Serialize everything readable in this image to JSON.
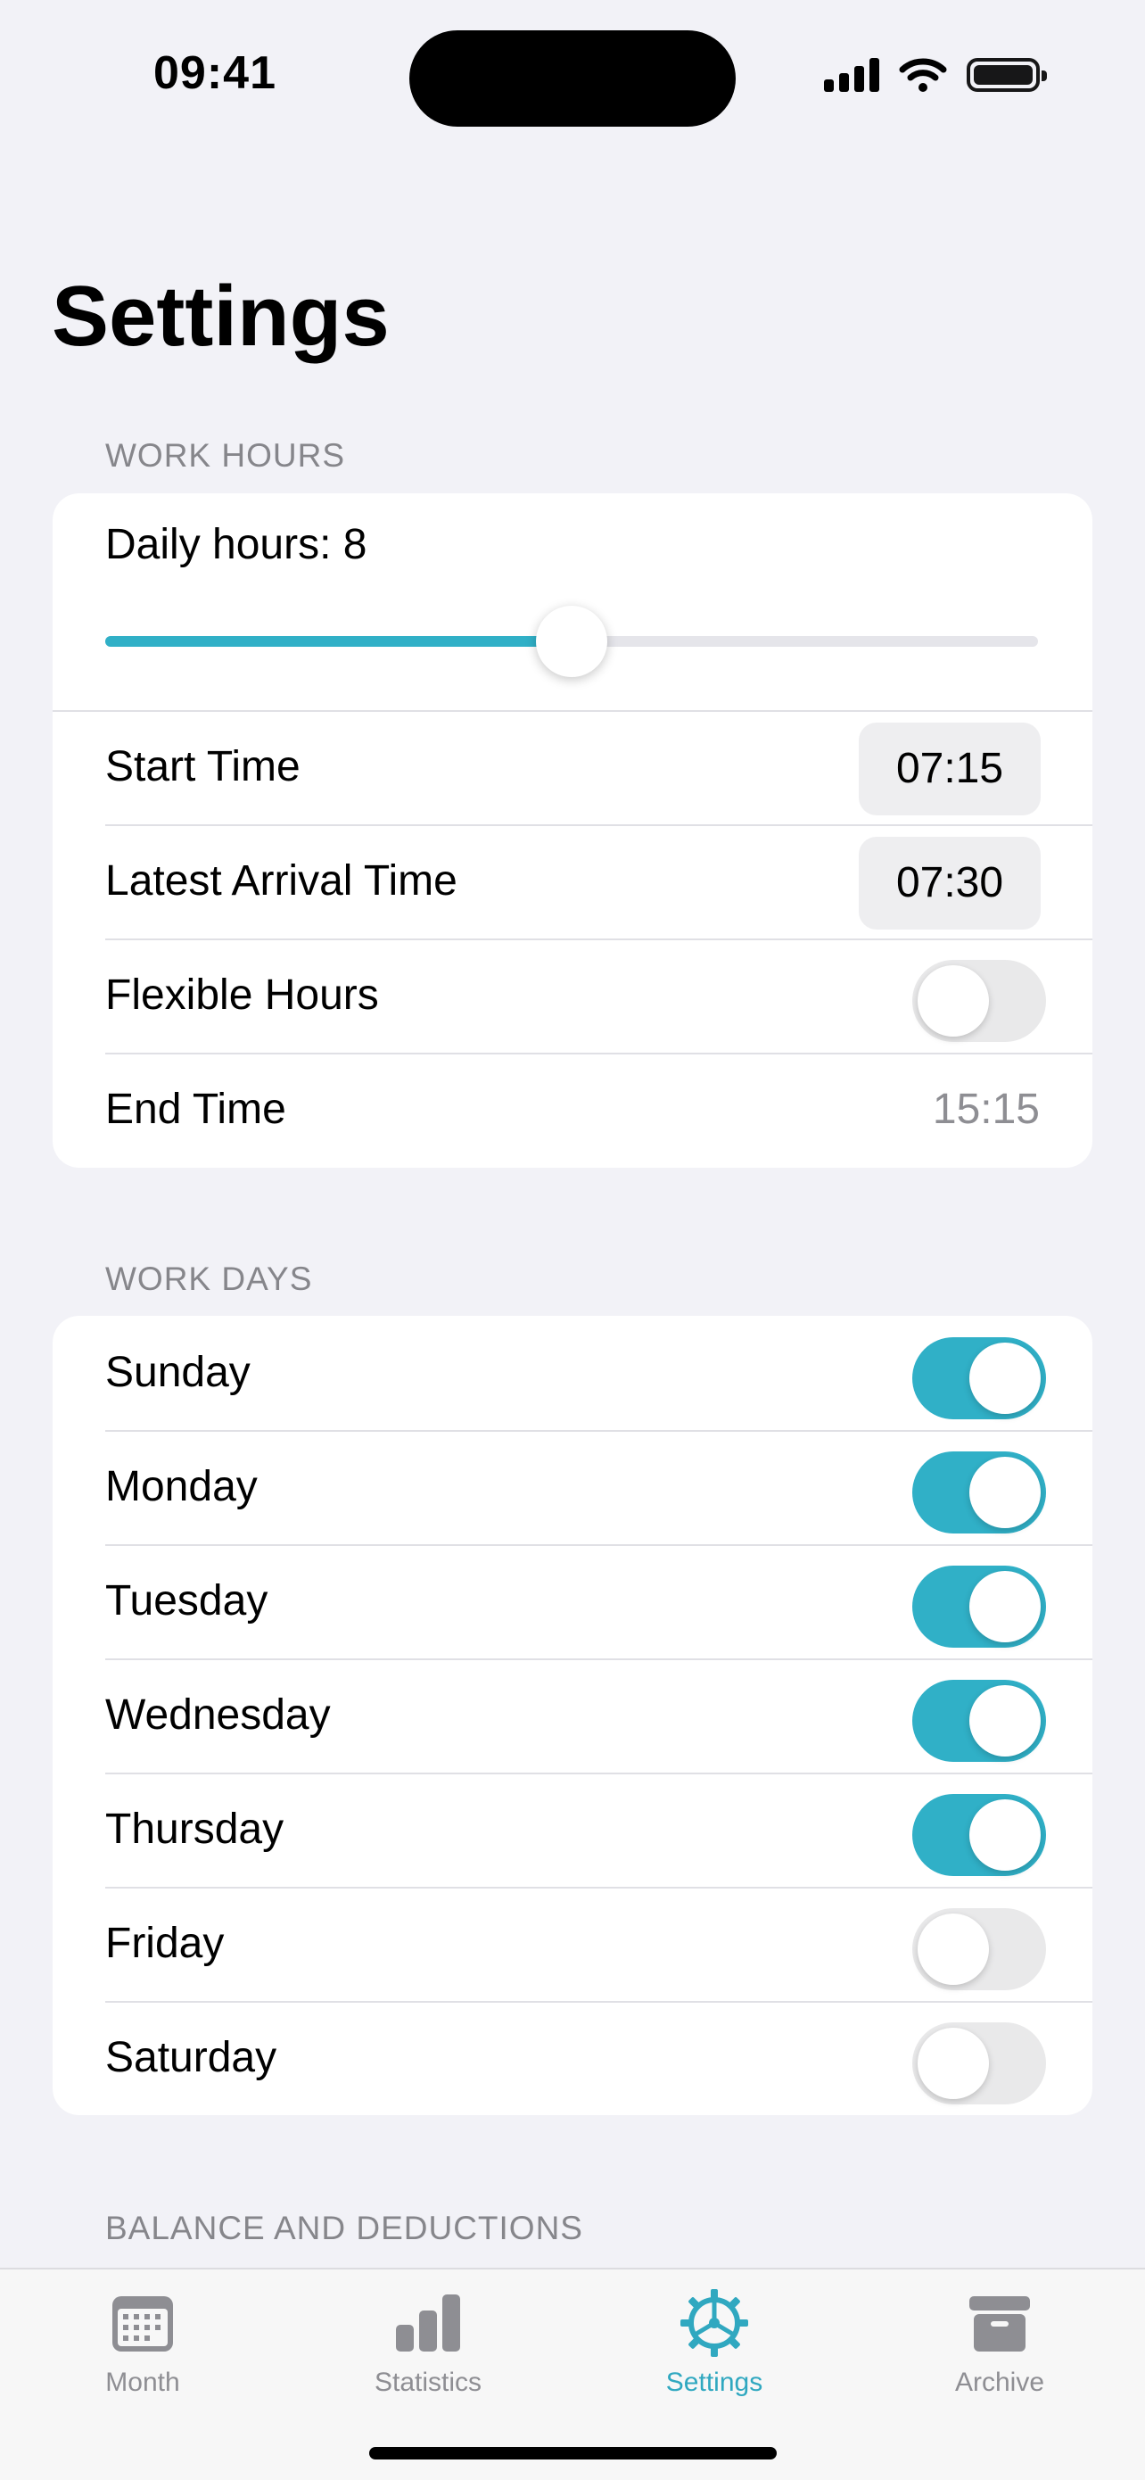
{
  "status_bar": {
    "time": "09:41"
  },
  "page_title": "Settings",
  "accent_color": "#30b0c7",
  "work_hours": {
    "header": "WORK HOURS",
    "daily_hours_label": "Daily hours: 8",
    "daily_hours_fraction": 0.5,
    "start_time_label": "Start Time",
    "start_time_value": "07:15",
    "latest_arrival_label": "Latest Arrival Time",
    "latest_arrival_value": "07:30",
    "flexible_hours_label": "Flexible Hours",
    "flexible_hours_on": false,
    "end_time_label": "End Time",
    "end_time_value": "15:15"
  },
  "work_days": {
    "header": "WORK DAYS",
    "days": [
      {
        "label": "Sunday",
        "on": true
      },
      {
        "label": "Monday",
        "on": true
      },
      {
        "label": "Tuesday",
        "on": true
      },
      {
        "label": "Wednesday",
        "on": true
      },
      {
        "label": "Thursday",
        "on": true
      },
      {
        "label": "Friday",
        "on": false
      },
      {
        "label": "Saturday",
        "on": false
      }
    ]
  },
  "balance_section": {
    "header": "BALANCE AND DEDUCTIONS"
  },
  "tab_bar": {
    "tabs": [
      {
        "label": "Month",
        "icon": "calendar-icon"
      },
      {
        "label": "Statistics",
        "icon": "bar-chart-icon"
      },
      {
        "label": "Settings",
        "icon": "gear-icon",
        "active": true
      },
      {
        "label": "Archive",
        "icon": "archive-box-icon"
      }
    ]
  }
}
